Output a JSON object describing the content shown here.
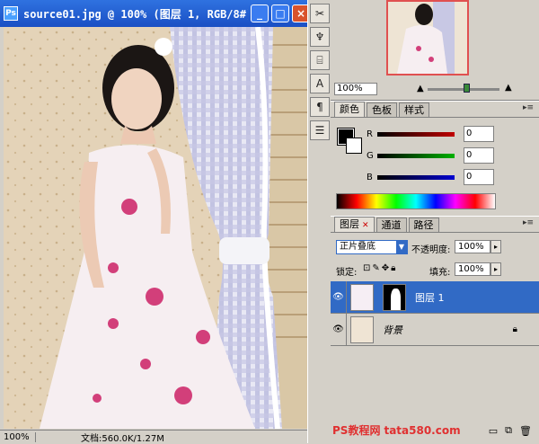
{
  "document": {
    "title": "source01.jpg @ 100% (图层 1, RGB/8#)",
    "status_zoom": "100%",
    "status_doc": "文档:560.0K/1.27M",
    "window_buttons": [
      "_",
      "□",
      "×"
    ]
  },
  "navigator": {
    "zoom": "100%"
  },
  "color_panel": {
    "tabs": [
      "颜色",
      "色板",
      "样式"
    ],
    "active_tab": "颜色",
    "channels": [
      {
        "label": "R",
        "value": "0",
        "color": "#c00000"
      },
      {
        "label": "G",
        "value": "0",
        "color": "#00a000"
      },
      {
        "label": "B",
        "value": "0",
        "color": "#0000c0"
      }
    ],
    "foreground": "#000000",
    "background": "#ffffff"
  },
  "layers_panel": {
    "tabs": [
      "图层",
      "通道",
      "路径"
    ],
    "active_tab": "图层",
    "blend_mode": "正片叠底",
    "opacity_label": "不透明度:",
    "opacity_value": "100%",
    "lock_label": "锁定:",
    "fill_label": "填充:",
    "fill_value": "100%",
    "layers": [
      {
        "name": "图层 1",
        "selected": true,
        "has_mask": true,
        "locked": false
      },
      {
        "name": "背景",
        "selected": false,
        "has_mask": false,
        "locked": true
      }
    ],
    "watermark_text": "PS教程网",
    "watermark_url": "tata580.com"
  },
  "colors": {
    "title_blue": "#1a4fc4",
    "selection_blue": "#316ac5",
    "panel_gray": "#d4d0c8"
  }
}
